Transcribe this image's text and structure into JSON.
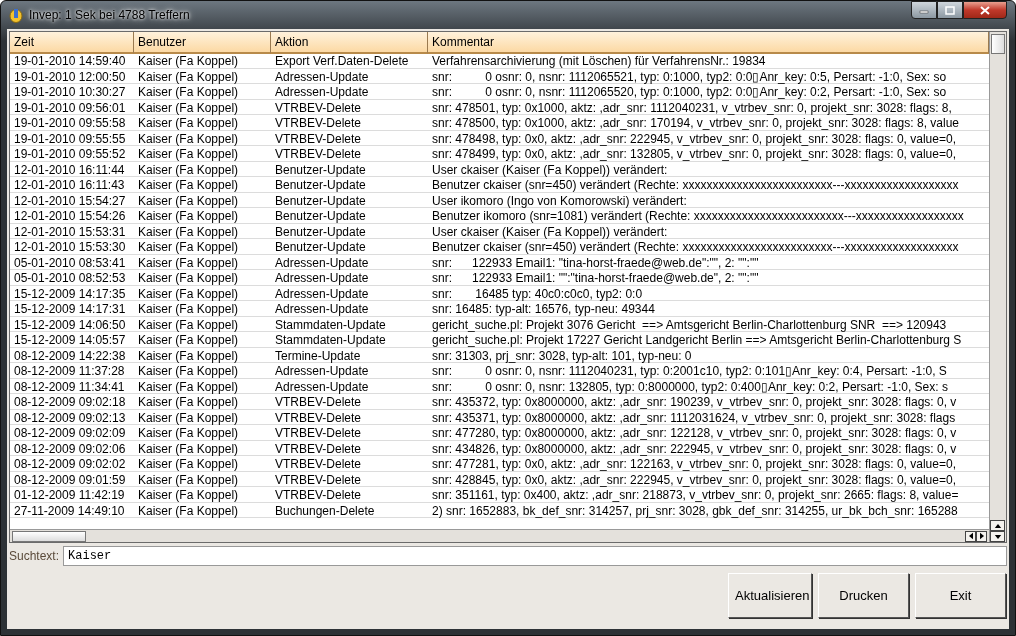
{
  "window": {
    "title": "Invep: 1 Sek bei 4788 Treffern"
  },
  "table": {
    "columns": [
      "Zeit",
      "Benutzer",
      "Aktion",
      "Kommentar"
    ],
    "rows": [
      [
        "19-01-2010 14:59:40",
        "Kaiser (Fa Koppel)",
        "Export Verf.Daten-Delete",
        "Verfahrensarchivierung (mit Löschen) für VerfahrensNr.: 19834"
      ],
      [
        "19-01-2010 12:00:50",
        "Kaiser (Fa Koppel)",
        "Adressen-Update",
        "snr:          0 osnr: 0, nsnr: 1112065521, typ: 0:1000, typ2: 0:0▯Anr_key: 0:5, Persart: -1:0, Sex: so"
      ],
      [
        "19-01-2010 10:30:27",
        "Kaiser (Fa Koppel)",
        "Adressen-Update",
        "snr:          0 osnr: 0, nsnr: 1112065520, typ: 0:1000, typ2: 0:0▯Anr_key: 0:2, Persart: -1:0, Sex: so"
      ],
      [
        "19-01-2010 09:56:01",
        "Kaiser (Fa Koppel)",
        "VTRBEV-Delete",
        "snr: 478501, typ: 0x1000, aktz: ,adr_snr: 1112040231, v_vtrbev_snr: 0, projekt_snr: 3028: flags: 8,"
      ],
      [
        "19-01-2010 09:55:58",
        "Kaiser (Fa Koppel)",
        "VTRBEV-Delete",
        "snr: 478500, typ: 0x1000, aktz: ,adr_snr: 170194, v_vtrbev_snr: 0, projekt_snr: 3028: flags: 8, value"
      ],
      [
        "19-01-2010 09:55:55",
        "Kaiser (Fa Koppel)",
        "VTRBEV-Delete",
        "snr: 478498, typ: 0x0, aktz: ,adr_snr: 222945, v_vtrbev_snr: 0, projekt_snr: 3028: flags: 0, value=0,"
      ],
      [
        "19-01-2010 09:55:52",
        "Kaiser (Fa Koppel)",
        "VTRBEV-Delete",
        "snr: 478499, typ: 0x0, aktz: ,adr_snr: 132805, v_vtrbev_snr: 0, projekt_snr: 3028: flags: 0, value=0,"
      ],
      [
        "12-01-2010 16:11:44",
        "Kaiser (Fa Koppel)",
        "Benutzer-Update",
        "User ckaiser (Kaiser (Fa Koppel)) verändert:"
      ],
      [
        "12-01-2010 16:11:43",
        "Kaiser (Fa Koppel)",
        "Benutzer-Update",
        "Benutzer ckaiser (snr=450) verändert (Rechte: xxxxxxxxxxxxxxxxxxxxxxxxx---xxxxxxxxxxxxxxxxxxx"
      ],
      [
        "12-01-2010 15:54:27",
        "Kaiser (Fa Koppel)",
        "Benutzer-Update",
        "User ikomoro (Ingo von Komorowski) verändert:"
      ],
      [
        "12-01-2010 15:54:26",
        "Kaiser (Fa Koppel)",
        "Benutzer-Update",
        "Benutzer ikomoro (snr=1081) verändert (Rechte: xxxxxxxxxxxxxxxxxxxxxxxxx---xxxxxxxxxxxxxxxxxx"
      ],
      [
        "12-01-2010 15:53:31",
        "Kaiser (Fa Koppel)",
        "Benutzer-Update",
        "User ckaiser (Kaiser (Fa Koppel)) verändert:"
      ],
      [
        "12-01-2010 15:53:30",
        "Kaiser (Fa Koppel)",
        "Benutzer-Update",
        "Benutzer ckaiser (snr=450) verändert (Rechte: xxxxxxxxxxxxxxxxxxxxxxxxx---xxxxxxxxxxxxxxxxxxx"
      ],
      [
        "05-01-2010 08:53:41",
        "Kaiser (Fa Koppel)",
        "Adressen-Update",
        "snr:      122933 Email1: \"tina-horst-fraede@web.de\":\"\", 2: \"\":\"\""
      ],
      [
        "05-01-2010 08:52:53",
        "Kaiser (Fa Koppel)",
        "Adressen-Update",
        "snr:      122933 Email1: \"\":\"tina-horst-fraede@web.de\", 2: \"\":\"\""
      ],
      [
        "15-12-2009 14:17:35",
        "Kaiser (Fa Koppel)",
        "Adressen-Update",
        "snr:       16485 typ: 40c0:c0c0, typ2: 0:0"
      ],
      [
        "15-12-2009 14:17:31",
        "Kaiser (Fa Koppel)",
        "Adressen-Update",
        "snr: 16485: typ-alt: 16576, typ-neu: 49344"
      ],
      [
        "15-12-2009 14:06:50",
        "Kaiser (Fa Koppel)",
        "Stammdaten-Update",
        "gericht_suche.pl: Projekt 3076 Gericht  ==> Amtsgericht Berlin-Charlottenburg SNR  ==> 120943"
      ],
      [
        "15-12-2009 14:05:57",
        "Kaiser (Fa Koppel)",
        "Stammdaten-Update",
        "gericht_suche.pl: Projekt 17227 Gericht Landgericht Berlin ==> Amtsgericht Berlin-Charlottenburg S"
      ],
      [
        "08-12-2009 14:22:38",
        "Kaiser (Fa Koppel)",
        "Termine-Update",
        "snr: 31303, prj_snr: 3028, typ-alt: 101, typ-neu: 0"
      ],
      [
        "08-12-2009 11:37:28",
        "Kaiser (Fa Koppel)",
        "Adressen-Update",
        "snr:          0 osnr: 0, nsnr: 1112040231, typ: 0:2001c10, typ2: 0:101▯Anr_key: 0:4, Persart: -1:0, S"
      ],
      [
        "08-12-2009 11:34:41",
        "Kaiser (Fa Koppel)",
        "Adressen-Update",
        "snr:          0 osnr: 0, nsnr: 132805, typ: 0:8000000, typ2: 0:400▯Anr_key: 0:2, Persart: -1:0, Sex: s"
      ],
      [
        "08-12-2009 09:02:18",
        "Kaiser (Fa Koppel)",
        "VTRBEV-Delete",
        "snr: 435372, typ: 0x8000000, aktz: ,adr_snr: 190239, v_vtrbev_snr: 0, projekt_snr: 3028: flags: 0, v"
      ],
      [
        "08-12-2009 09:02:13",
        "Kaiser (Fa Koppel)",
        "VTRBEV-Delete",
        "snr: 435371, typ: 0x8000000, aktz: ,adr_snr: 1112031624, v_vtrbev_snr: 0, projekt_snr: 3028: flags"
      ],
      [
        "08-12-2009 09:02:09",
        "Kaiser (Fa Koppel)",
        "VTRBEV-Delete",
        "snr: 477280, typ: 0x8000000, aktz: ,adr_snr: 122128, v_vtrbev_snr: 0, projekt_snr: 3028: flags: 0, v"
      ],
      [
        "08-12-2009 09:02:06",
        "Kaiser (Fa Koppel)",
        "VTRBEV-Delete",
        "snr: 434826, typ: 0x8000000, aktz: ,adr_snr: 222945, v_vtrbev_snr: 0, projekt_snr: 3028: flags: 0, v"
      ],
      [
        "08-12-2009 09:02:02",
        "Kaiser (Fa Koppel)",
        "VTRBEV-Delete",
        "snr: 477281, typ: 0x0, aktz: ,adr_snr: 122163, v_vtrbev_snr: 0, projekt_snr: 3028: flags: 0, value=0,"
      ],
      [
        "08-12-2009 09:01:59",
        "Kaiser (Fa Koppel)",
        "VTRBEV-Delete",
        "snr: 428845, typ: 0x0, aktz: ,adr_snr: 222945, v_vtrbev_snr: 0, projekt_snr: 3028: flags: 0, value=0,"
      ],
      [
        "01-12-2009 11:42:19",
        "Kaiser (Fa Koppel)",
        "VTRBEV-Delete",
        "snr: 351161, typ: 0x400, aktz: ,adr_snr: 218873, v_vtrbev_snr: 0, projekt_snr: 2665: flags: 8, value="
      ],
      [
        "27-11-2009 14:49:10",
        "Kaiser (Fa Koppel)",
        "Buchungen-Delete",
        "2) snr: 1652883, bk_def_snr: 314257, prj_snr: 3028, gbk_def_snr: 314255, ur_bk_bch_snr: 165288"
      ]
    ]
  },
  "search": {
    "label": "Suchtext:",
    "value": "Kaiser"
  },
  "buttons": [
    "Aktualisieren",
    "Drucken",
    "Exit"
  ]
}
